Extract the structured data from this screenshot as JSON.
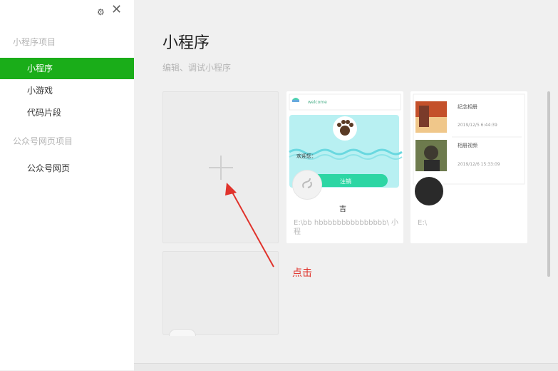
{
  "window": {
    "settings_icon": "gear-icon",
    "close_icon": "close-icon"
  },
  "sidebar": {
    "section_miniprogram": "小程序项目",
    "items": [
      {
        "label": "小程序",
        "active": true
      },
      {
        "label": "小游戏",
        "active": false
      },
      {
        "label": "代码片段",
        "active": false
      }
    ],
    "section_official": "公众号网页项目",
    "official_items": [
      {
        "label": "公众号网页"
      }
    ]
  },
  "main": {
    "title": "小程序",
    "subtitle": "编辑、调试小程序",
    "new_project_icon": "plus-icon",
    "projects": [
      {
        "thumb_header": "welcome",
        "thumb_welcome_text": "欢迎您：",
        "thumb_button": "注销",
        "name": "吉",
        "path": "E:\\bb                    hbbbbbbbbbbbbbbb\\             小程"
      },
      {
        "thumb_item1_title": "纪念相册",
        "thumb_item1_time": "2019/12/5 6:44:39",
        "thumb_item2_title": "相册视频",
        "thumb_item2_time": "2019/12/6 15:33:09",
        "path": "E:\\"
      }
    ],
    "annotation": "点击"
  },
  "colors": {
    "accent": "#1aad19",
    "annotation": "#e0332c",
    "background": "#f0f0f0"
  }
}
